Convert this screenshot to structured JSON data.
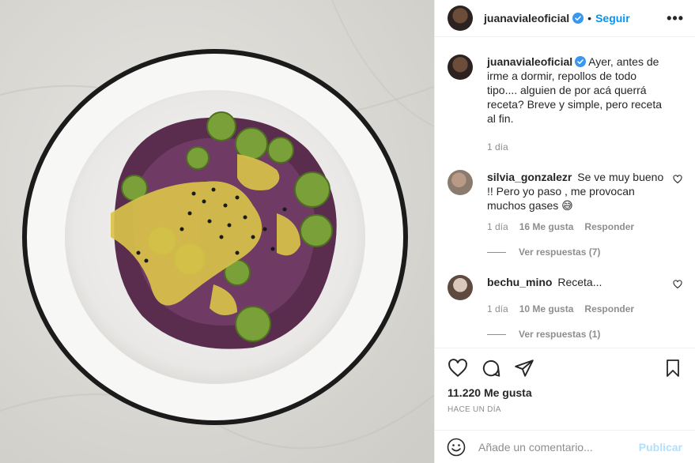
{
  "post": {
    "username": "juanavialeoficial",
    "follow_label": "Seguir",
    "more_label": "•••",
    "caption": "Ayer, antes de irme a dormir, repollos de todo tipo.... alguien de por acá querrá receta? Breve y simple, pero receta al fin.",
    "caption_time": "1 día",
    "likes": "11.220 Me gusta",
    "posted_ago": "HACE UN DÍA",
    "add_comment_placeholder": "Añade un comentario...",
    "publish_label": "Publicar"
  },
  "comments": [
    {
      "username": "silvia_gonzalezr",
      "text": "Se ve muy bueno !! Pero yo paso , me provocan muchos gases 😅",
      "time": "1 día",
      "likes": "16 Me gusta",
      "reply_label": "Responder",
      "view_replies": "Ver respuestas (7)"
    },
    {
      "username": "bechu_mino",
      "text": "Receta...",
      "time": "1 día",
      "likes": "10 Me gusta",
      "reply_label": "Responder",
      "view_replies": "Ver respuestas (1)"
    }
  ],
  "icons": {
    "verified": "verified-badge-icon",
    "like": "heart-icon",
    "comment": "comment-icon",
    "share": "share-icon",
    "save": "bookmark-icon",
    "emoji": "smile-icon"
  },
  "colors": {
    "link_blue": "#0095f6",
    "publish_disabled": "#b2dffc",
    "muted": "#8e8e8e"
  }
}
